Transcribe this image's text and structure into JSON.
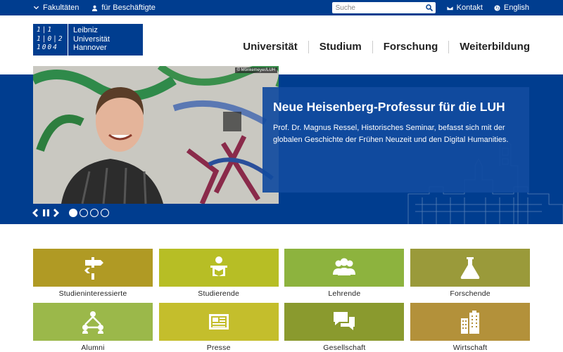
{
  "topbar": {
    "faculties": "Fakultäten",
    "employees": "für Beschäftigte",
    "search_placeholder": "Suche",
    "contact": "Kontakt",
    "language": "English"
  },
  "logo": {
    "mark_lines": [
      "1|1",
      "1|0|2",
      "1004"
    ],
    "name_lines": [
      "Leibniz",
      "Universität",
      "Hannover"
    ]
  },
  "nav": [
    "Universität",
    "Studium",
    "Forschung",
    "Weiterbildung"
  ],
  "hero": {
    "copyright": "© Mönkemeyer/LUH",
    "title": "Neue Heisenberg-Professur für die LUH",
    "text": "Prof. Dr. Magnus Ressel, Historisches Seminar, befasst sich mit der globa­len Geschichte der Frühen Neuzeit und den Digital Humanities.",
    "slide_count": 4,
    "active_slide": 0
  },
  "tiles": [
    {
      "label": "Studieninteressierte",
      "color": "#b09a24",
      "icon": "signpost-icon"
    },
    {
      "label": "Studierende",
      "color": "#b7be25",
      "icon": "student-icon"
    },
    {
      "label": "Lehrende",
      "color": "#8db33e",
      "icon": "group-icon"
    },
    {
      "label": "Forschende",
      "color": "#9a9a3a",
      "icon": "flask-icon"
    },
    {
      "label": "Alumni",
      "color": "#9bb84a",
      "icon": "network-icon"
    },
    {
      "label": "Presse",
      "color": "#c4be2c",
      "icon": "newspaper-icon"
    },
    {
      "label": "Gesellschaft",
      "color": "#8a9a2e",
      "icon": "chat-icon"
    },
    {
      "label": "Wirtschaft",
      "color": "#b3913a",
      "icon": "buildings-icon"
    }
  ],
  "colors": {
    "brand_blue": "#003d8f",
    "teaser_blue": "#114ba0"
  }
}
